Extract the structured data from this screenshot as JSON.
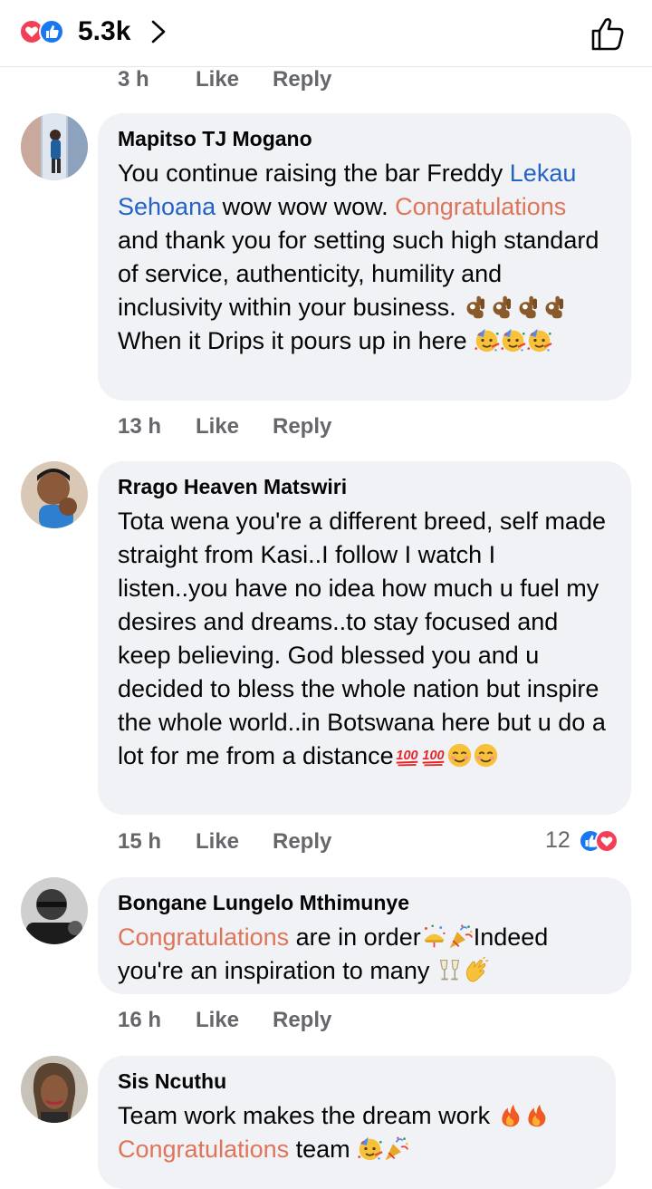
{
  "header": {
    "reaction_count": "5.3k",
    "reaction_icons": [
      "love-icon",
      "like-icon"
    ],
    "chevron_icon": "chevron-right-icon",
    "like_icon": "thumbs-up-outline-icon"
  },
  "labels": {
    "like": "Like",
    "reply": "Reply"
  },
  "previous_comment": {
    "time": "3 h"
  },
  "comments": [
    {
      "author": "Mapitso TJ Mogano",
      "segments": [
        "You continue raising the bar  Freddy ",
        "Lekau Sehoana",
        " wow wow wow. ",
        "Congratulations",
        " and thank you for setting such high standard of service, authenticity, humility and inclusivity within your business. ",
        " When it Drips it pours up in here "
      ],
      "emoji": [
        "ok-hand-emoji",
        "partying-face-emoji"
      ],
      "time": "13 h"
    },
    {
      "author": "Rrago Heaven Matswiri",
      "text": "Tota wena you're a different breed, self made straight from Kasi..I follow I watch I listen..you have no idea how much u fuel my desires and dreams..to stay focused and keep believing. God blessed you and u decided to bless the whole nation but inspire the whole world..in Botswana here but u do a lot for me from a distance",
      "emoji": [
        "hundred-points-emoji",
        "relieved-face-emoji"
      ],
      "time": "15 h",
      "reactions": {
        "count": "12",
        "icons": [
          "like-icon",
          "love-icon"
        ]
      }
    },
    {
      "author": "Bongane Lungelo Mthimunye",
      "segments": [
        "Congratulations",
        " are in order",
        "Indeed you're an inspiration to many "
      ],
      "emoji": [
        "confetti-ball-emoji",
        "party-popper-emoji",
        "clinking-glasses-emoji",
        "clapping-hands-emoji"
      ],
      "time": "16 h"
    },
    {
      "author": "Sis Ncuthu",
      "segments": [
        "Team work makes the dream work ",
        "Congratulations",
        " team "
      ],
      "emoji": [
        "fire-emoji",
        "partying-face-emoji",
        "party-popper-emoji"
      ]
    }
  ],
  "colors": {
    "mention": "#2463c7",
    "highlight": "#e07458",
    "meta": "#65676b",
    "bubble": "#f0f2f5",
    "like_blue": "#1877f2",
    "love_red": "#f33e58"
  }
}
